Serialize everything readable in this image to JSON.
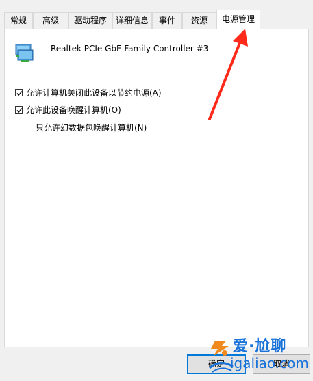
{
  "tabs": [
    {
      "label": "常规",
      "active": false
    },
    {
      "label": "高级",
      "active": false
    },
    {
      "label": "驱动程序",
      "active": false
    },
    {
      "label": "详细信息",
      "active": false
    },
    {
      "label": "事件",
      "active": false
    },
    {
      "label": "资源",
      "active": false
    },
    {
      "label": "电源管理",
      "active": true
    }
  ],
  "device": {
    "name": "Realtek PCIe GbE Family Controller #3",
    "icon": "network-adapter-icon"
  },
  "options": [
    {
      "label": "允许计算机关闭此设备以节约电源(A)",
      "checked": true
    },
    {
      "label": "允许此设备唤醒计算机(O)",
      "checked": true
    },
    {
      "label": "只允许幻数据包唤醒计算机(N)",
      "checked": false
    }
  ],
  "buttons": {
    "ok": "确定",
    "cancel": "取消"
  },
  "watermark": {
    "title": "爱·尬聊",
    "url": "igaliao.com"
  },
  "colors": {
    "accent": "#0078d7",
    "arrow": "#ff2a1a",
    "watermark": "#1a73d9"
  }
}
